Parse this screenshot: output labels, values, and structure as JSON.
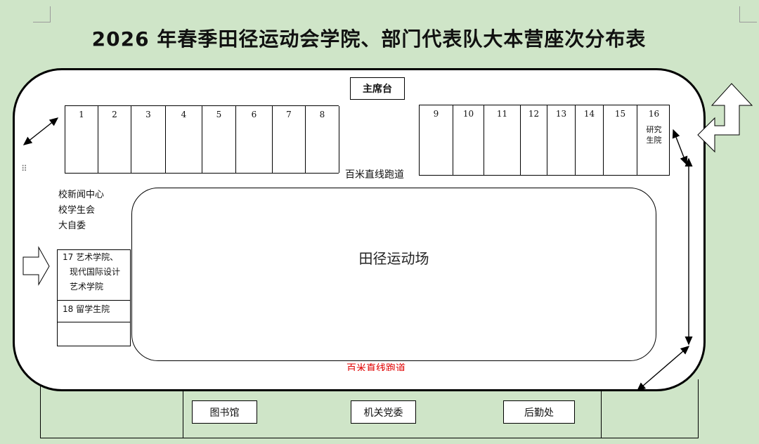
{
  "title": "2026 年春季田径运动会学院、部门代表队大本营座次分布表",
  "stand": {
    "label": "主席台"
  },
  "left_block": {
    "seats": [
      "1",
      "2",
      "3",
      "4",
      "5",
      "6",
      "7",
      "8"
    ]
  },
  "right_block": {
    "seats": [
      "9",
      "10",
      "11",
      "12",
      "13",
      "14",
      "15",
      "16"
    ],
    "seat16_note": [
      "研究",
      "生院"
    ]
  },
  "track_labels": {
    "top": "百米直线跑道",
    "bottom": "百米直线跑道"
  },
  "left_group": {
    "lines": [
      "校新闻中心",
      "校学生会",
      "大自委"
    ]
  },
  "seat17": {
    "lines": [
      "17 艺术学院、",
      "现代国际设计",
      "艺术学院"
    ]
  },
  "seat18": {
    "text": "18  留学生院"
  },
  "field_label": "田径运动场",
  "bottom_buildings": [
    "图书馆",
    "机关党委",
    "后勤处"
  ],
  "colors": {
    "background": "#cfe5c8",
    "bottom_track_text": "#e00000"
  }
}
